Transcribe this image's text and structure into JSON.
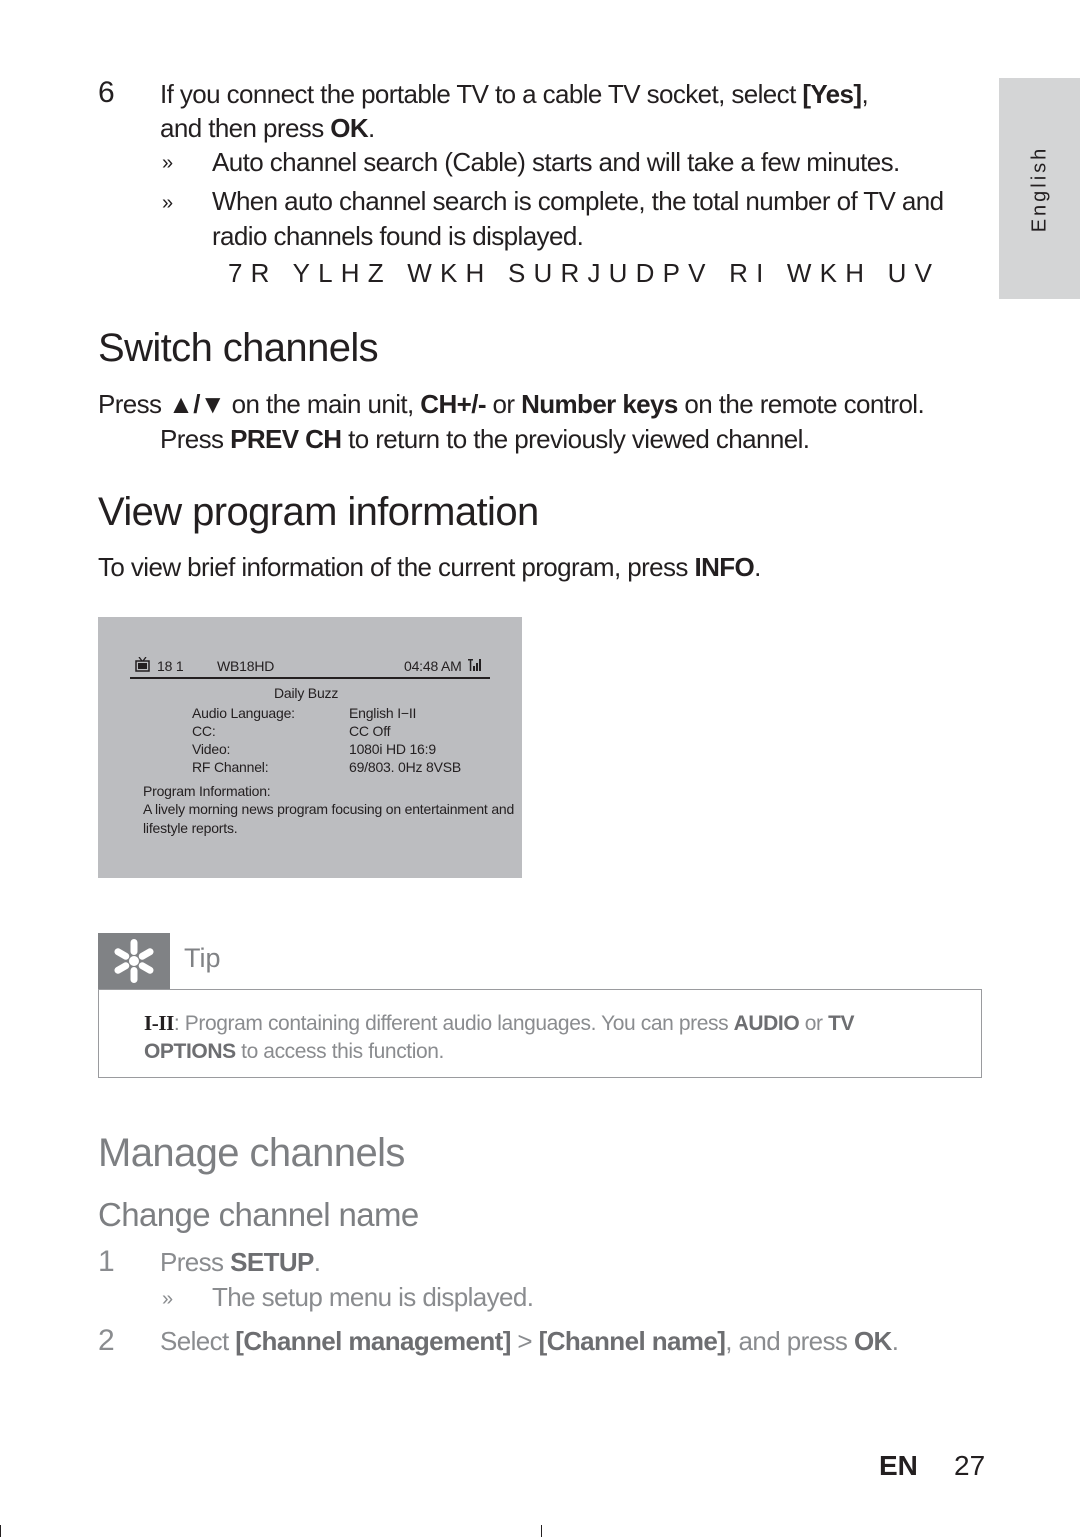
{
  "side_tab": {
    "label": "English"
  },
  "step6": {
    "number": "6",
    "text_pre": "If you connect the portable TV to a cable TV socket, select ",
    "yes": "[Yes]",
    "text_mid": ",",
    "line2_pre": "and then press ",
    "ok": "OK",
    "line2_post": ".",
    "results": [
      {
        "bullet": "»",
        "text": "Auto channel search (Cable) starts and will take a few minutes."
      },
      {
        "bullet": "»",
        "text": "When auto channel search is complete, the total number of TV and",
        "text2": "radio channels found is displayed."
      }
    ],
    "garbled": "7R YLHZ WKH SURJUDPV RI WKH UV"
  },
  "switch_channels": {
    "title": "Switch channels",
    "line1_pre": "Press ",
    "arrows": "▲/▼",
    "line1_mid": " on the main unit, ",
    "ch": "CH+/-",
    "or": " or ",
    "number_keys": "Number keys",
    "line1_post": " on the remote control.",
    "line2_pre": "Press ",
    "prev_ch": "PREV CH",
    "line2_post": " to return to the previously viewed channel."
  },
  "view_program": {
    "title": "View program information",
    "text_pre": "To view brief information of the current program, press ",
    "info": "INFO",
    "text_post": "."
  },
  "screen": {
    "tv_icon": "tv-icon",
    "channel": "18 1",
    "station": "WB18HD",
    "time": "04:48 AM",
    "signal_icon": "signal-icon",
    "program_title": "Daily Buzz",
    "rows": [
      {
        "label": "Audio Language:",
        "value": "English I−II"
      },
      {
        "label": "CC:",
        "value": "CC Off"
      },
      {
        "label": "Video:",
        "value": "1080i HD 16:9"
      },
      {
        "label": "RF Channel:",
        "value": "69/803. 0Hz 8VSB"
      }
    ],
    "info_label": "Program Information:",
    "info_line1": "A lively  morning news program focusing on entertainment and",
    "info_line2": "lifestyle reports."
  },
  "tip": {
    "label": "Tip",
    "symbol": "I-II",
    "text_pre": ": Program containing different audio languages. You can press ",
    "audio": "AUDIO",
    "or": " or ",
    "tv": "TV",
    "options": "OPTIONS",
    "text_post": " to access this function."
  },
  "manage": {
    "title": "Manage channels",
    "subtitle": "Change channel name",
    "steps": [
      {
        "number": "1",
        "pre": "Press ",
        "key": "SETUP",
        "post": ".",
        "result": {
          "bullet": "»",
          "text": "The setup menu is displayed."
        }
      },
      {
        "number": "2",
        "pre": "Select ",
        "k1": "[Channel management]",
        "sep": " > ",
        "k2": "[Channel name]",
        "mid": ", and press ",
        "k3": "OK",
        "post": "."
      }
    ]
  },
  "footer": {
    "lang": "EN",
    "page": "27"
  }
}
